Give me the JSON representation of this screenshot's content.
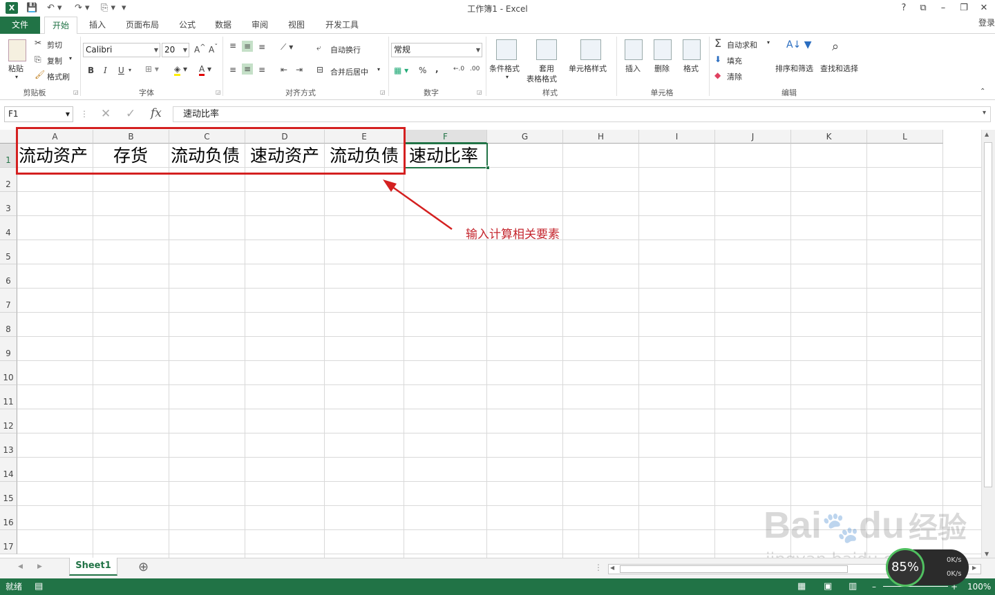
{
  "window": {
    "title": "工作簿1 - Excel",
    "help": "?",
    "login": "登录"
  },
  "tabs": {
    "file": "文件",
    "items": [
      "开始",
      "插入",
      "页面布局",
      "公式",
      "数据",
      "审阅",
      "视图",
      "开发工具"
    ]
  },
  "ribbon": {
    "clipboard": {
      "paste": "粘贴",
      "cut": "剪切",
      "copy": "复制",
      "painter": "格式刷",
      "label": "剪贴板"
    },
    "font": {
      "name": "Calibri",
      "size": "20",
      "bold": "B",
      "italic": "I",
      "underline": "U",
      "label": "字体"
    },
    "alignment": {
      "wrap": "自动换行",
      "merge": "合并后居中",
      "label": "对齐方式"
    },
    "number": {
      "format": "常规",
      "percent": "%",
      "comma": ",",
      "label": "数字"
    },
    "styles": {
      "conditional": "条件格式",
      "table_line1": "套用",
      "table_line2": "表格格式",
      "cell_styles": "单元格样式",
      "label": "样式"
    },
    "cells": {
      "insert": "插入",
      "delete": "删除",
      "format": "格式",
      "label": "单元格"
    },
    "editing": {
      "autosum": "自动求和",
      "fill": "填充",
      "clear": "清除",
      "sort": "排序和筛选",
      "find": "查找和选择",
      "label": "编辑"
    }
  },
  "formula_bar": {
    "name_box": "F1",
    "fx": "fx",
    "content": "速动比率"
  },
  "grid": {
    "columns": [
      "A",
      "B",
      "C",
      "D",
      "E",
      "F",
      "G",
      "H",
      "I",
      "J",
      "K",
      "L"
    ],
    "rows": [
      "1",
      "2",
      "3",
      "4",
      "5",
      "6",
      "7",
      "8",
      "9",
      "10",
      "11",
      "12",
      "13",
      "14",
      "15",
      "16",
      "17"
    ],
    "row1": [
      "流动资产",
      "存货",
      "流动负债",
      "速动资产",
      "流动负债",
      "速动比率"
    ]
  },
  "annotation": {
    "text": "输入计算相关要素",
    "color": "#c4262e"
  },
  "sheets": {
    "active": "Sheet1",
    "add": "⊕"
  },
  "status": {
    "ready": "就绪",
    "zoom": "100%"
  },
  "watermark": {
    "brand": "Bai",
    "brand2": "du",
    "brand_cn": "经验",
    "url": "jingyan.baidu.com"
  },
  "net_widget": {
    "percent": "85%",
    "up": "0K/s",
    "down": "0K/s"
  },
  "colors": {
    "excel_green": "#217346",
    "annotation_red": "#d42020"
  }
}
